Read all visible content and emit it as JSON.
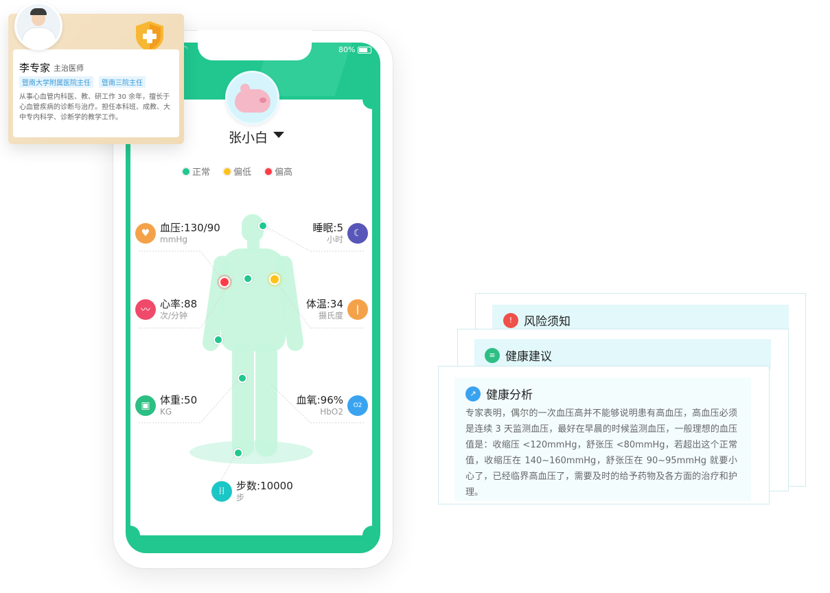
{
  "doctor": {
    "name": "李专家",
    "title": "主治医师",
    "tags": [
      "暨南大学附属医院主任",
      "暨南三院主任"
    ],
    "description": "从事心血管内科医、教、研工作 30 余年，擅长于心血管疾病的诊断与治疗。担任本科班、成教、大中专内科学、诊断学的教学工作。"
  },
  "phone": {
    "battery": "80%",
    "user_name": "张小白",
    "legend": [
      {
        "label": "正常",
        "color": "#21c78f"
      },
      {
        "label": "偏低",
        "color": "#ffc21a"
      },
      {
        "label": "偏高",
        "color": "#ff3b48"
      }
    ],
    "metrics": {
      "blood_pressure": {
        "value": "血压:130/90",
        "unit": "mmHg",
        "color": "#f4a24a",
        "icon": "blood-pressure-icon"
      },
      "sleep": {
        "value": "睡眠:5",
        "unit": "小时",
        "color": "#5856b8",
        "icon": "moon-icon"
      },
      "heart_rate": {
        "value": "心率:88",
        "unit": "次/分钟",
        "color": "#ef4a6a",
        "icon": "heartbeat-icon"
      },
      "temperature": {
        "value": "体温:34",
        "unit": "摄氏度",
        "color": "#f4a24a",
        "icon": "thermometer-icon"
      },
      "weight": {
        "value": "体重:50",
        "unit": "KG",
        "color": "#2dbe84",
        "icon": "scale-icon"
      },
      "blood_oxygen": {
        "value": "血氧:96%",
        "unit": "HbO2",
        "color": "#3aa3f0",
        "icon": "oxygen-icon"
      },
      "steps": {
        "value": "步数:10000",
        "unit": "步",
        "color": "#1cc6c6",
        "icon": "footprints-icon"
      }
    }
  },
  "cards": {
    "risk": {
      "title": "风险须知",
      "color": "#f0504a",
      "icon": "risk-icon"
    },
    "advice": {
      "title": "健康建议",
      "color": "#2dbe84",
      "icon": "chat-icon"
    },
    "analysis": {
      "title": "健康分析",
      "color": "#3aa3f0",
      "icon": "chart-icon",
      "text": "专家表明，偶尔的一次血压高并不能够说明患有高血压，高血压必须是连续 3 天监测血压，最好在早晨的时候监测血压，一般理想的血压值是：收缩压 <120mmHg，舒张压 <80mmHg，若超出这个正常值，收缩压在 140~160mmHg，舒张压在 90~95mmHg 就要小心了，已经临界高血压了，需要及时的给予药物及各方面的治疗和护理。"
    }
  }
}
